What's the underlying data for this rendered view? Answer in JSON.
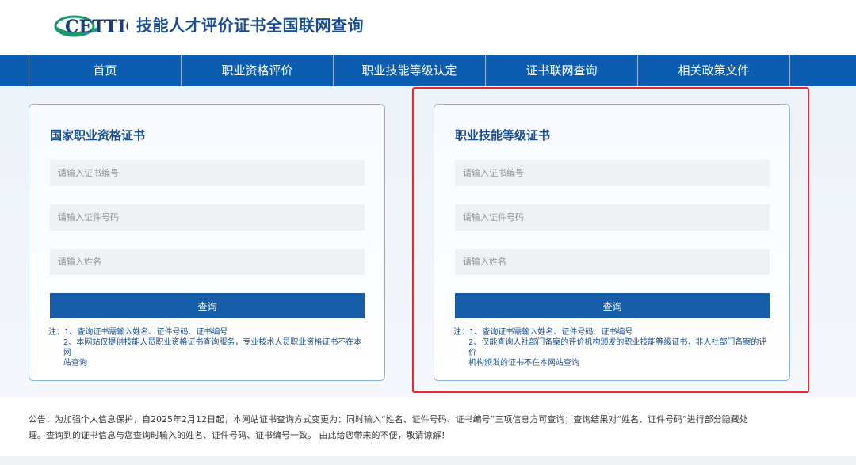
{
  "header": {
    "logo_text": "CETTIC",
    "title": "技能人才评价证书全国联网查询"
  },
  "nav": {
    "items": [
      "首页",
      "职业资格评价",
      "职业技能等级认定",
      "证书联网查询",
      "相关政策文件"
    ]
  },
  "cards": [
    {
      "title": "国家职业资格证书",
      "cert_no_placeholder": "请输入证书编号",
      "id_no_placeholder": "请输入证件号码",
      "name_placeholder": "请输入姓名",
      "button_label": "查询",
      "note_1": "注：1、查询证书需输入姓名、证件号码、证书编号",
      "note_2a": "2、本网站仅提供技能人员职业资格证书查询服务，专业技术人员职业资格证书不在本网",
      "note_2b": "站查询"
    },
    {
      "title": "职业技能等级证书",
      "cert_no_placeholder": "请输入证书编号",
      "id_no_placeholder": "请输入证件号码",
      "name_placeholder": "请输入姓名",
      "button_label": "查询",
      "note_1": "注：1、查询证书需输入姓名、证件号码、证书编号",
      "note_2a": "2、仅能查询人社部门备案的评价机构颁发的职业技能等级证书，非人社部门备案的评价",
      "note_2b": "机构颁发的证书不在本网站查询"
    }
  ],
  "announcement": {
    "line_1": "公告：为加强个人信息保护，自2025年2月12日起，本网站证书查询方式变更为：同时输入“姓名、证件号码、证书编号”三项信息方可查询；查询结果对“姓名、证件号码”进行部分隐藏处",
    "line_2": "理。查询到的证书信息与您查询时输入的姓名、证件号码、证书编号一致。 由此给您带来的不便，敬请谅解！"
  },
  "colors": {
    "brand_blue": "#0b5db1",
    "title_blue": "#1a4f93",
    "logo_green": "#1a9a6b",
    "highlight_red": "#e8282b"
  }
}
